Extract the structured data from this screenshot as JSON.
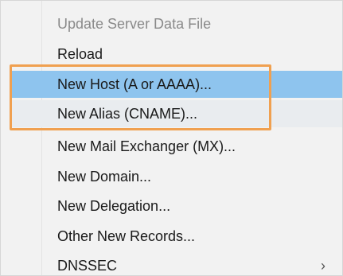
{
  "menu": {
    "items": [
      {
        "label": "Update Server Data File",
        "state": "disabled"
      },
      {
        "label": "Reload",
        "state": "normal"
      },
      {
        "label": "New Host (A or AAAA)...",
        "state": "hover"
      },
      {
        "label": "New Alias (CNAME)...",
        "state": "highlighted"
      },
      {
        "label": "New Mail Exchanger (MX)...",
        "state": "normal"
      },
      {
        "label": "New Domain...",
        "state": "normal"
      },
      {
        "label": "New Delegation...",
        "state": "normal"
      },
      {
        "label": "Other New Records...",
        "state": "normal"
      },
      {
        "label": "DNSSEC",
        "state": "normal",
        "submenu_icon": "chevron-right-icon",
        "submenu_glyph": "›"
      }
    ]
  },
  "colors": {
    "hover_background": "#8ec4ee",
    "callout_border": "#f0a050",
    "disabled_text": "#8a8a8a"
  }
}
